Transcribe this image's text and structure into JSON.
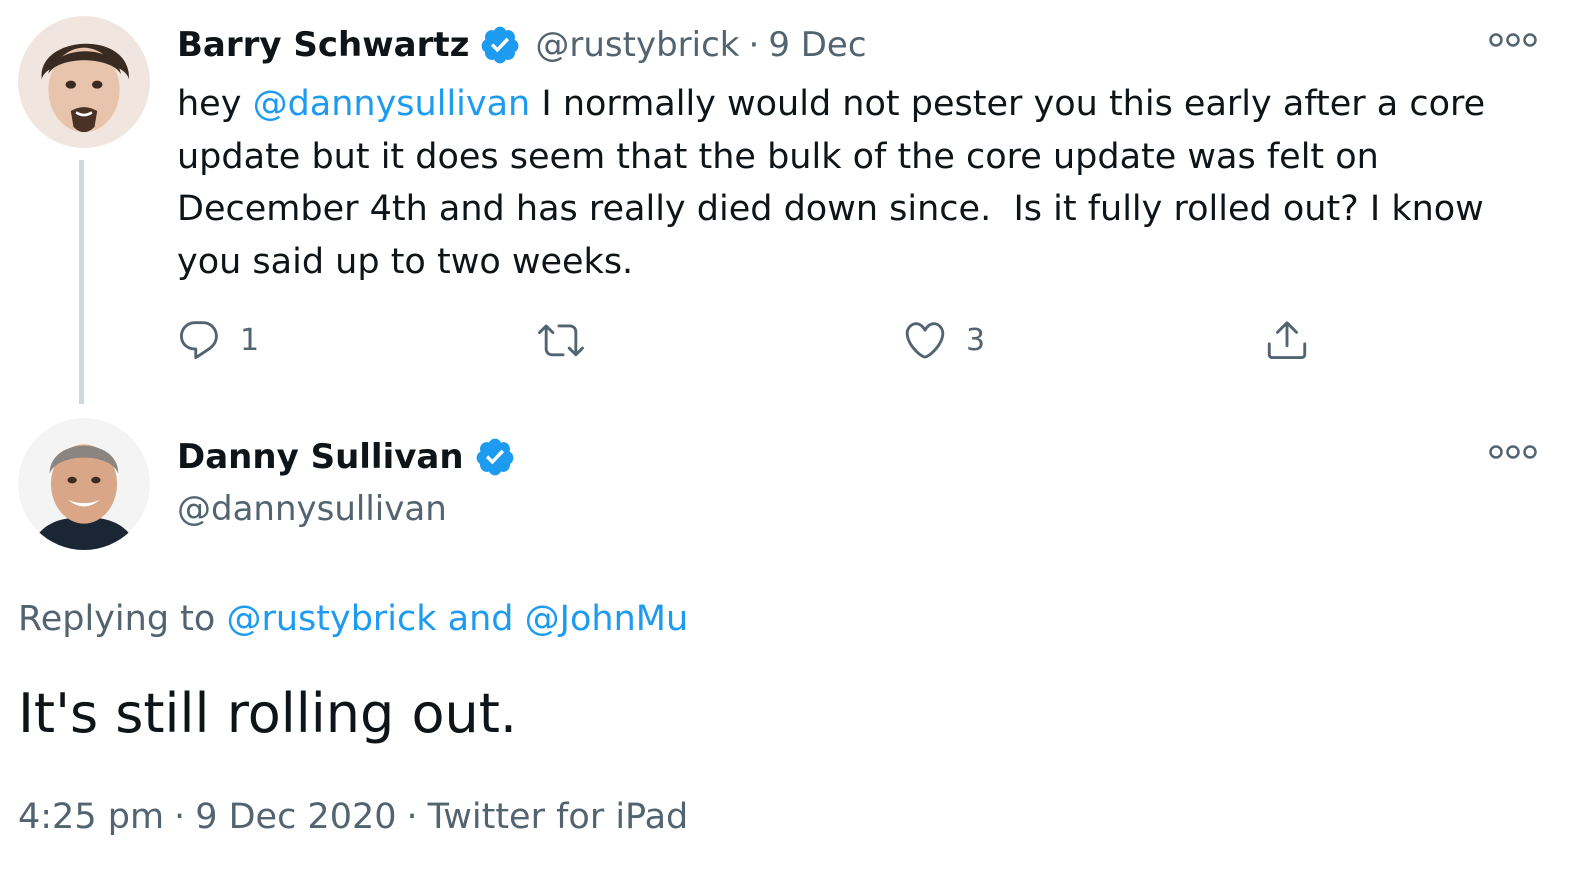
{
  "parent_tweet": {
    "author": {
      "name": "Barry Schwartz",
      "handle": "@rustybrick",
      "verified": true,
      "avatar": "avatar-photo-barry"
    },
    "separator": "·",
    "date": "9 Dec",
    "text": {
      "prefix": "hey ",
      "mention": "@dannysullivan",
      "body": " I normally would not pester you this early after a core update but it does seem that the bulk of the core update was felt on December 4th and has really died down since.  Is it fully rolled out? I know you said up to two weeks."
    },
    "actions": {
      "reply": {
        "icon": "reply-icon",
        "count": "1"
      },
      "retweet": {
        "icon": "retweet-icon",
        "count": ""
      },
      "like": {
        "icon": "heart-icon",
        "count": "3"
      },
      "share": {
        "icon": "share-icon"
      }
    }
  },
  "main_tweet": {
    "author": {
      "name": "Danny Sullivan",
      "handle": "@dannysullivan",
      "verified": true,
      "avatar": "avatar-photo-danny"
    },
    "replying": {
      "prefix": "Replying to ",
      "user1": "@rustybrick",
      "conj": " and ",
      "user2": "@JohnMu"
    },
    "text": "It's still rolling out.",
    "meta": {
      "time": "4:25 pm",
      "separator": "·",
      "date": "9 Dec 2020",
      "source": "Twitter for iPad"
    }
  },
  "colors": {
    "accent": "#1d9bf0",
    "text": "#0f1419",
    "secondary": "#536471",
    "thread_line": "#cfd9de"
  }
}
